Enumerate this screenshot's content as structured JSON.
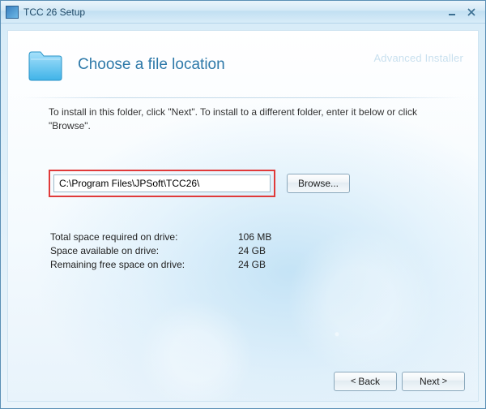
{
  "window": {
    "title": "TCC 26 Setup"
  },
  "watermark": "Advanced Installer",
  "heading": "Choose a file location",
  "instruction": "To install in this folder, click \"Next\". To install to a different folder, enter it below or click \"Browse\".",
  "path": {
    "value": "C:\\Program Files\\JPSoft\\TCC26\\",
    "browse_label": "Browse..."
  },
  "stats": {
    "required_label": "Total space required on drive:",
    "required_value": "106 MB",
    "available_label": "Space available on drive:",
    "available_value": "24 GB",
    "remaining_label": "Remaining free space on drive:",
    "remaining_value": "24 GB"
  },
  "footer": {
    "back_label": "Back",
    "next_label": "Next"
  }
}
